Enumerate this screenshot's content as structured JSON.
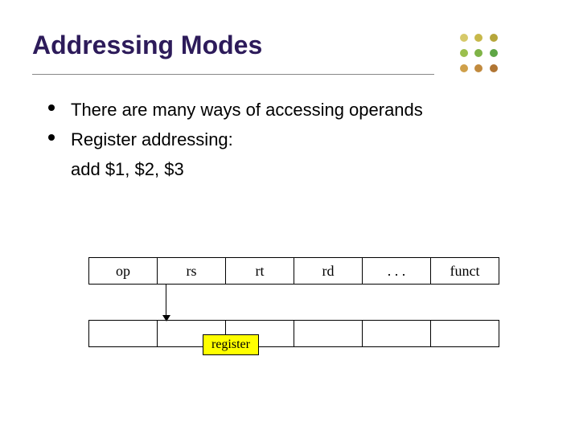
{
  "title": "Addressing Modes",
  "bullets": {
    "b1": "There are many ways of accessing operands",
    "b2": "Register addressing:",
    "example": "add $1, $2, $3"
  },
  "instruction_fields": {
    "f0": "op",
    "f1": "rs",
    "f2": "rt",
    "f3": "rd",
    "f4": ". . .",
    "f5": "funct"
  },
  "register_box": "register",
  "decor_colors": {
    "c0": "#d6c96a",
    "c1": "#c7b84a",
    "c2": "#b6a63b",
    "c3": "#9bbf4d",
    "c4": "#7fb347",
    "c5": "#5ea645",
    "c6": "#cfa04a",
    "c7": "#c18a3e",
    "c8": "#b07533"
  }
}
